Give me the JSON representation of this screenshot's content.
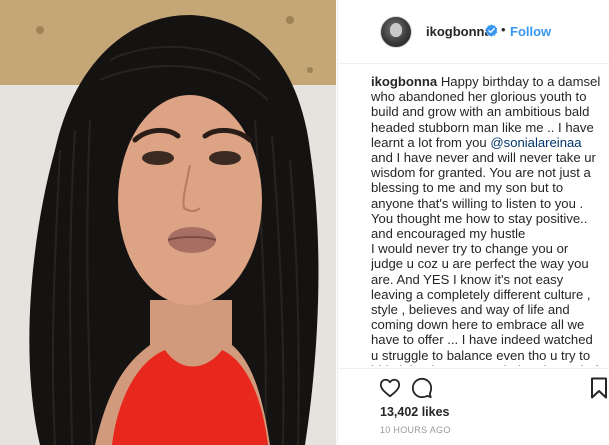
{
  "post": {
    "username": "ikogbonna",
    "follow_separator": "•",
    "follow_label": "Follow",
    "caption_user": "ikogbonna",
    "caption_part1": " Happy birthday to a damsel who abandoned her glorious youth to build and grow with an ambitious bald headed stubborn man like me .. I have learnt a lot from you ",
    "caption_mention": "@sonialareinaa",
    "caption_part2": " and I have never and will never take ur wisdom for granted. You are not just a blessing to me and my son but to anyone that's willing to listen to you . You thought me how to stay positive.. and encouraged my hustle",
    "caption_part3": "I would never try to change you or judge u coz u are perfect the way you are. And YES I know it's not easy leaving a completely different culture , style , believes and way of life and coming down here to embrace all we have to offer ... I have indeed watched u struggle to balance even tho u try to hide it but hey .. I am glad and proud of the woman you have become 😮😮😮😮😮 my MOTTO still remains - let",
    "likes": "13,402 likes",
    "timestamp": "10 HOURS AGO"
  },
  "colors": {
    "accent": "#3897f0",
    "text": "#262626",
    "muted": "#999999",
    "dress": "#e8281c"
  },
  "icons": {
    "verified": "verified-badge-icon",
    "like": "heart-icon",
    "comment": "comment-icon",
    "save": "bookmark-icon"
  }
}
